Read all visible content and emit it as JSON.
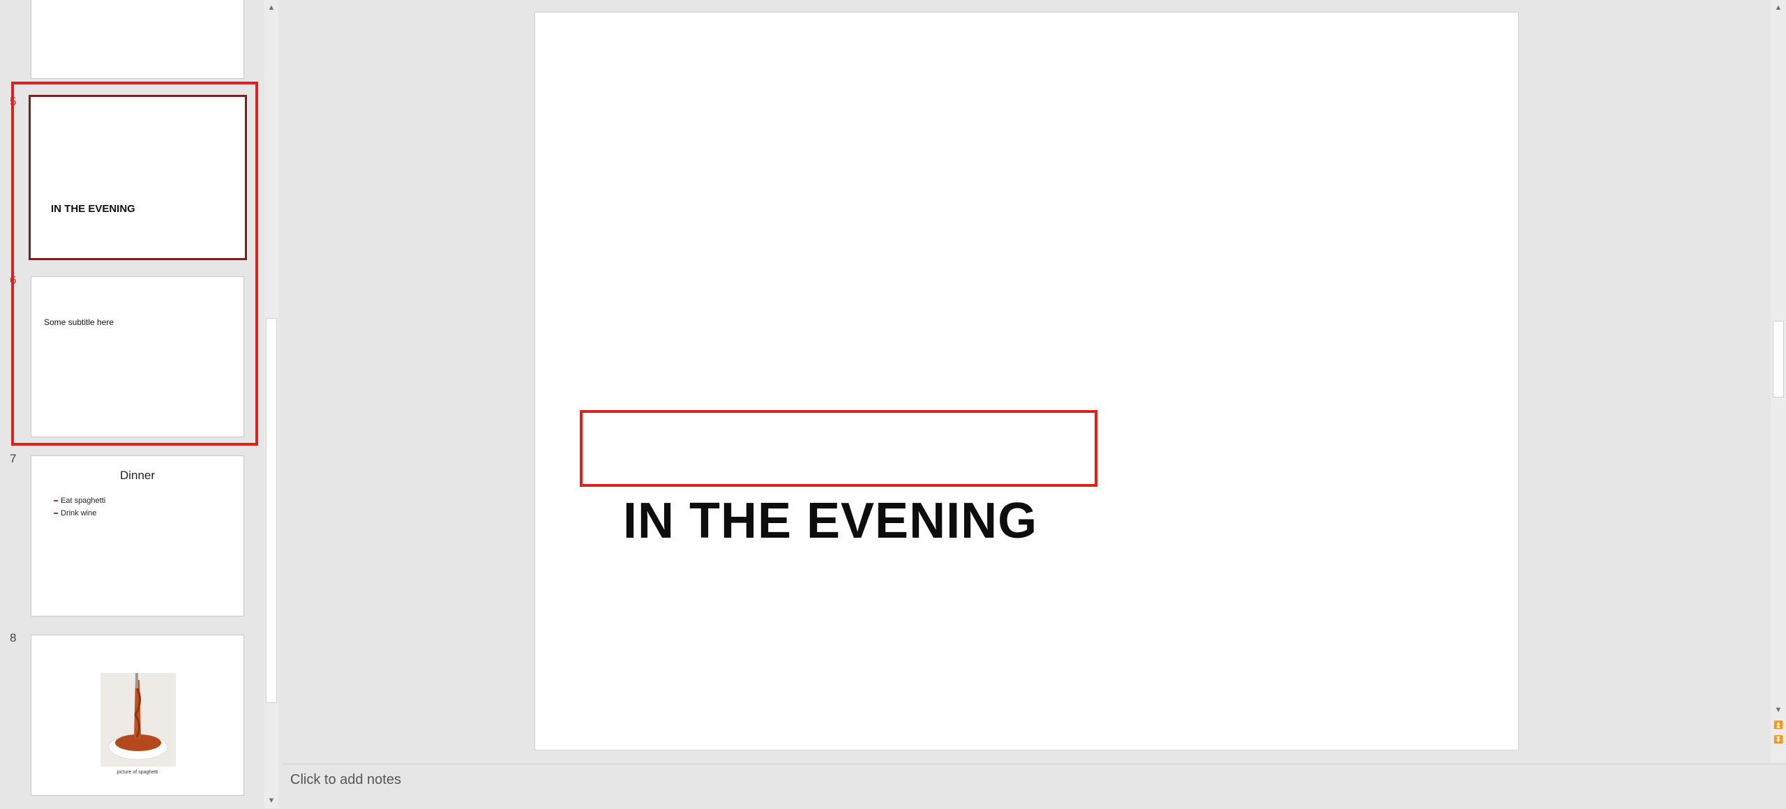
{
  "thumbnails": {
    "slides": [
      {
        "number": "5",
        "title": "IN THE EVENING"
      },
      {
        "number": "6",
        "subtitle": "Some subtitle here"
      },
      {
        "number": "7",
        "title": "Dinner",
        "bullets": [
          "Eat spaghetti",
          "Drink wine"
        ]
      },
      {
        "number": "8",
        "caption": "picture of spaghetti"
      }
    ]
  },
  "slide": {
    "title": "IN THE EVENING"
  },
  "notes": {
    "placeholder": "Click to add notes"
  },
  "colors": {
    "highlight": "#e0201f",
    "selected_border": "#7a1f1f",
    "background": "#e6e6e6"
  },
  "icons": [
    "scroll-up-icon",
    "scroll-down-icon",
    "previous-slide-icon",
    "next-slide-icon"
  ]
}
